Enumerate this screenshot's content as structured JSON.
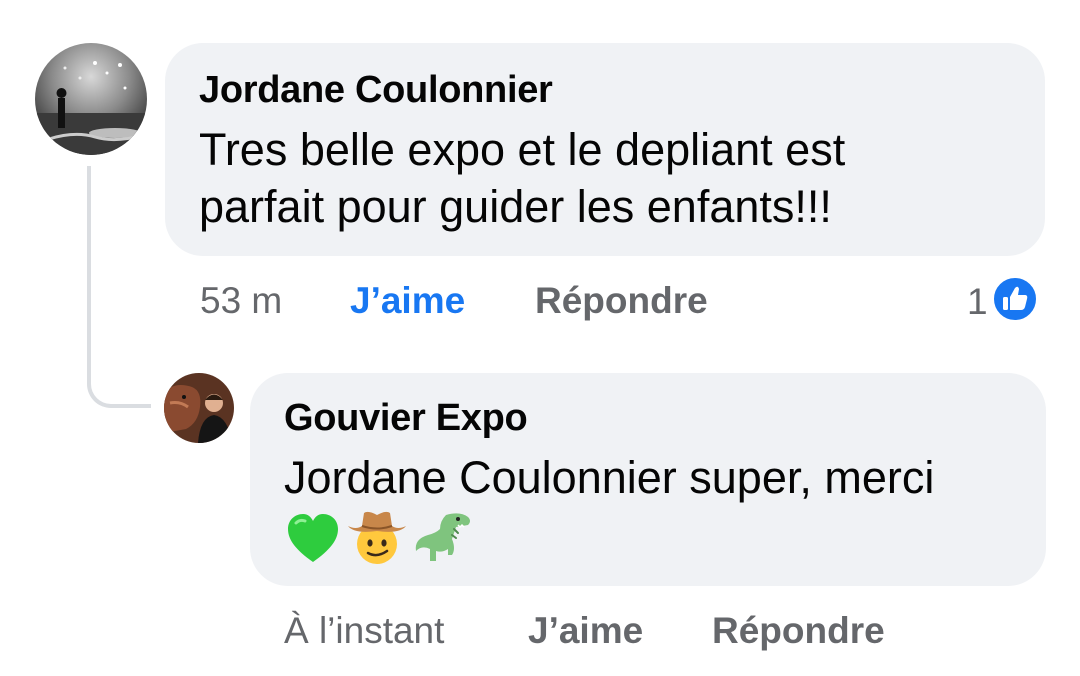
{
  "comment": {
    "author": "Jordane Coulonnier",
    "text_line1": "Tres belle expo et le depliant est",
    "text_line2": "parfait pour guider les enfants!!!",
    "time": "53 m",
    "like_label": "J’aime",
    "reply_label": "Répondre",
    "reaction_count": "1",
    "reaction_icon": "like-thumb-icon"
  },
  "reply": {
    "author": "Gouvier Expo",
    "text_line1": "Jordane Coulonnier super, merci",
    "emojis": [
      "green-heart-emoji",
      "cowboy-face-emoji",
      "t-rex-emoji"
    ],
    "time": "À l’instant",
    "like_label": "J’aime",
    "reply_label": "Répondre"
  },
  "colors": {
    "bubble": "#f0f2f5",
    "action_gray": "#65676b",
    "like_blue": "#1877f2",
    "thread_line": "#dadde1"
  }
}
